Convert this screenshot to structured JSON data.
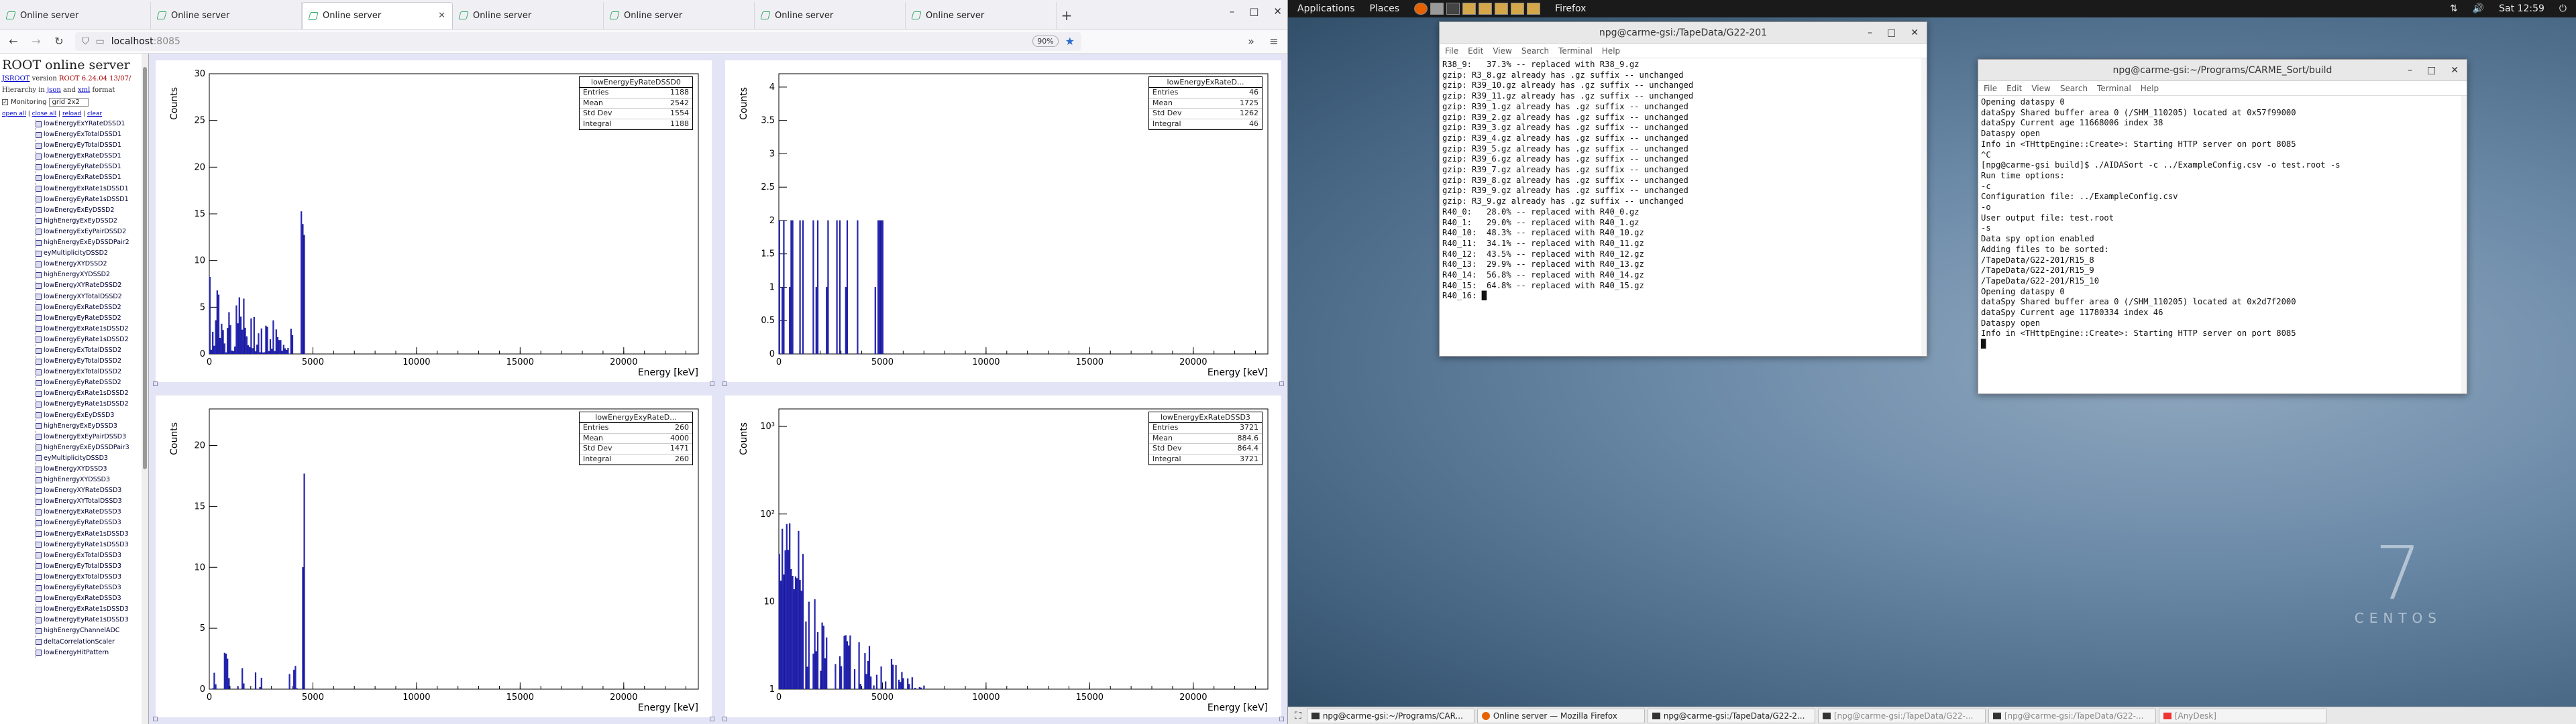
{
  "browser": {
    "tabs": [
      {
        "label": "Online server",
        "active": false
      },
      {
        "label": "Online server",
        "active": false
      },
      {
        "label": "Online server",
        "active": true
      },
      {
        "label": "Online server",
        "active": false
      },
      {
        "label": "Online server",
        "active": false
      },
      {
        "label": "Online server",
        "active": false
      },
      {
        "label": "Online server",
        "active": false
      }
    ],
    "new_tab": "+",
    "url_host": "localhost",
    "url_port": ":8085",
    "zoom": "90%",
    "win_min": "–",
    "win_max": "□",
    "win_close": "✕"
  },
  "sidebar": {
    "title": "ROOT online server",
    "version_prefix": "JSROOT",
    "version_mid": "version",
    "version_val": "ROOT 6.24.04 13/07/",
    "hier_text": "Hierarchy in",
    "hier_json": "json",
    "hier_and": "and",
    "hier_xml": "xml",
    "hier_format": "format",
    "monitoring": "Monitoring",
    "layout": "grid 2x2",
    "link_open": "open all",
    "link_close": "close all",
    "link_reload": "reload",
    "link_clear": "clear",
    "items": [
      "lowEnergyExYRateDSSD1",
      "lowEnergyExTotalDSSD1",
      "lowEnergyEyTotalDSSD1",
      "lowEnergyExRateDSSD1",
      "lowEnergyEyRateDSSD1",
      "lowEnergyExRateDSSD1",
      "lowEnergyExRate1sDSSD1",
      "lowEnergyEyRate1sDSSD1",
      "lowEnergyExEyDSSD2",
      "highEnergyExEyDSSD2",
      "lowEnergyExEyPairDSSD2",
      "highEnergyExEyDSSDPair2",
      "eyMultiplicityDSSD2",
      "lowEnergyXYDSSD2",
      "highEnergyXYDSSD2",
      "lowEnergyXYRateDSSD2",
      "lowEnergyXYTotalDSSD2",
      "lowEnergyExRateDSSD2",
      "lowEnergyEyRateDSSD2",
      "lowEnergyExRate1sDSSD2",
      "lowEnergyEyRate1sDSSD2",
      "lowEnergyExTotalDSSD2",
      "lowEnergyEyTotalDSSD2",
      "lowEnergyExTotalDSSD2",
      "lowEnergyEyRateDSSD2",
      "lowEnergyExRate1sDSSD2",
      "lowEnergyEyRate1sDSSD2",
      "lowEnergyExEyDSSD3",
      "highEnergyExEyDSSD3",
      "lowEnergyExEyPairDSSD3",
      "highEnergyExEyDSSDPair3",
      "eyMultiplicityDSSD3",
      "lowEnergyXYDSSD3",
      "highEnergyXYDSSD3",
      "lowEnergyXYRateDSSD3",
      "lowEnergyXYTotalDSSD3",
      "lowEnergyExRateDSSD3",
      "lowEnergyEyRateDSSD3",
      "lowEnergyExRate1sDSSD3",
      "lowEnergyEyRate1sDSSD3",
      "lowEnergyExTotalDSSD3",
      "lowEnergyEyTotalDSSD3",
      "lowEnergyExTotalDSSD3",
      "lowEnergyEyRateDSSD3",
      "lowEnergyExRateDSSD3",
      "lowEnergyExRate1sDSSD3",
      "lowEnergyEyRate1sDSSD3",
      "highEnergyChannelADC",
      "deltaCorrelationScaler",
      "lowEnergyHitPattern"
    ]
  },
  "pads": [
    {
      "stats_title": "lowEnergyEyRateDSSD0",
      "Entries": "1188",
      "Mean": "2542",
      "Std Dev": "1554",
      "Integral": "1188",
      "xlabel": "Energy [keV]",
      "ylabel": "Counts",
      "log": false,
      "yticks": [
        "0",
        "5",
        "10",
        "15",
        "20",
        "25",
        "30"
      ],
      "ymax": 30
    },
    {
      "stats_title": "lowEnergyExRateD...",
      "Entries": "46",
      "Mean": "1725",
      "Std Dev": "1262",
      "Integral": "46",
      "xlabel": "Energy [keV]",
      "ylabel": "Counts",
      "log": false,
      "yticks": [
        "0",
        "0.5",
        "1",
        "1.5",
        "2",
        "2.5",
        "3",
        "3.5",
        "4"
      ],
      "ymax": 4.2
    },
    {
      "stats_title": "lowEnergyExyRateD...",
      "Entries": "260",
      "Mean": "4000",
      "Std Dev": "1471",
      "Integral": "260",
      "xlabel": "Energy [keV]",
      "ylabel": "Counts",
      "log": false,
      "yticks": [
        "0",
        "5",
        "10",
        "15",
        "20"
      ],
      "ymax": 23
    },
    {
      "stats_title": "lowEnergyExRateDSSD3",
      "Entries": "3721",
      "Mean": "884.6",
      "Std Dev": "864.4",
      "Integral": "3721",
      "xlabel": "Energy [keV]",
      "ylabel": "Counts",
      "log": true,
      "yticks": [
        "1",
        "10",
        "10²",
        "10³"
      ],
      "ymax": 1000
    }
  ],
  "xticks": [
    "0",
    "5000",
    "10000",
    "15000",
    "20000"
  ],
  "desktop": {
    "apps": "Applications",
    "places": "Places",
    "firefox": "Firefox",
    "clock": "Sat 12:59",
    "brand_num": "7",
    "brand_word": "CENTOS"
  },
  "term1": {
    "title": "npg@carme-gsi:/TapeData/G22-201",
    "menu": [
      "File",
      "Edit",
      "View",
      "Search",
      "Terminal",
      "Help"
    ],
    "text": "R38_9:   37.3% -- replaced with R38_9.gz\ngzip: R3_8.gz already has .gz suffix -- unchanged\ngzip: R39_10.gz already has .gz suffix -- unchanged\ngzip: R39_11.gz already has .gz suffix -- unchanged\ngzip: R39_1.gz already has .gz suffix -- unchanged\ngzip: R39_2.gz already has .gz suffix -- unchanged\ngzip: R39_3.gz already has .gz suffix -- unchanged\ngzip: R39_4.gz already has .gz suffix -- unchanged\ngzip: R39_5.gz already has .gz suffix -- unchanged\ngzip: R39_6.gz already has .gz suffix -- unchanged\ngzip: R39_7.gz already has .gz suffix -- unchanged\ngzip: R39_8.gz already has .gz suffix -- unchanged\ngzip: R39_9.gz already has .gz suffix -- unchanged\ngzip: R3_9.gz already has .gz suffix -- unchanged\nR40_0:   28.0% -- replaced with R40_0.gz\nR40_1:   29.0% -- replaced with R40_1.gz\nR40_10:  48.3% -- replaced with R40_10.gz\nR40_11:  34.1% -- replaced with R40_11.gz\nR40_12:  43.5% -- replaced with R40_12.gz\nR40_13:  29.9% -- replaced with R40_13.gz\nR40_14:  56.8% -- replaced with R40_14.gz\nR40_15:  64.8% -- replaced with R40_15.gz\nR40_16: █"
  },
  "term2": {
    "title": "npg@carme-gsi:~/Programs/CARME_Sort/build",
    "menu": [
      "File",
      "Edit",
      "View",
      "Search",
      "Terminal",
      "Help"
    ],
    "text": "Opening dataspy 0\ndataSpy Shared buffer area 0 (/SHM_110205) located at 0x57f99000\ndataSpy Current age 11668006 index 38\nDataspy open\nInfo in <THttpEngine::Create>: Starting HTTP server on port 8085\n^C\n[npg@carme-gsi build]$ ./AIDASort -c ../ExampleConfig.csv -o test.root -s\nRun time options:\n-c\nConfiguration file: ../ExampleConfig.csv\n-o\nUser output file: test.root\n-s\nData spy option enabled\nAdding files to be sorted:\n/TapeData/G22-201/R15_8\n/TapeData/G22-201/R15_9\n/TapeData/G22-201/R15_10\nOpening dataspy 0\ndataSpy Shared buffer area 0 (/SHM_110205) located at 0x2d7f2000\ndataSpy Current age 11780334 index 46\nDataspy open\nInfo in <THttpEngine::Create>: Starting HTTP server on port 8085\n█"
  },
  "taskbar": [
    {
      "label": "npg@carme-gsi:~/Programs/CAR...",
      "dim": false,
      "icon": "terminal-icon"
    },
    {
      "label": "Online server — Mozilla Firefox",
      "dim": false,
      "icon": "firefox-icon"
    },
    {
      "label": "npg@carme-gsi:/TapeData/G22-2...",
      "dim": false,
      "icon": "terminal-icon"
    },
    {
      "label": "[npg@carme-gsi:/TapeData/G22-...",
      "dim": true,
      "icon": "terminal-icon"
    },
    {
      "label": "[npg@carme-gsi:/TapeData/G22-...",
      "dim": true,
      "icon": "terminal-icon"
    },
    {
      "label": "[AnyDesk]",
      "dim": true,
      "icon": "anydesk-icon"
    }
  ]
}
